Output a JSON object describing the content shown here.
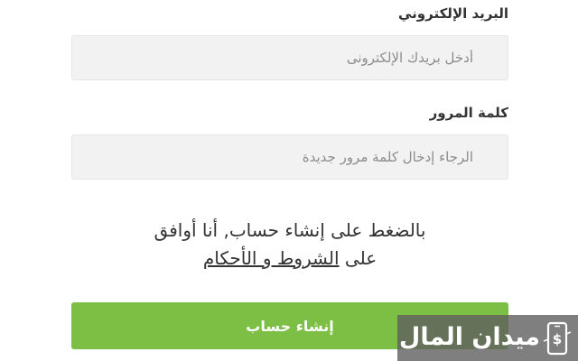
{
  "form": {
    "email_label": "البريد الإلكتروني",
    "email_placeholder": "أدخل بريدك الإلكترونى",
    "password_label": "كلمة المرور",
    "password_placeholder": "الرجاء إدخال كلمة مرور جديدة",
    "terms_line1": "بالضغط على إنشاء حساب, أنا أوافق",
    "terms_line2_prefix": "على",
    "terms_link": "الشروط و الأحكام",
    "submit_label": "إنشاء حساب"
  },
  "watermark": {
    "text": "ميدان المال",
    "icon": "money-phone-icon"
  },
  "colors": {
    "button": "#7cbf44",
    "input_bg": "#f2f2f2",
    "text": "#333333",
    "watermark_bg": "#5f5f5f"
  }
}
